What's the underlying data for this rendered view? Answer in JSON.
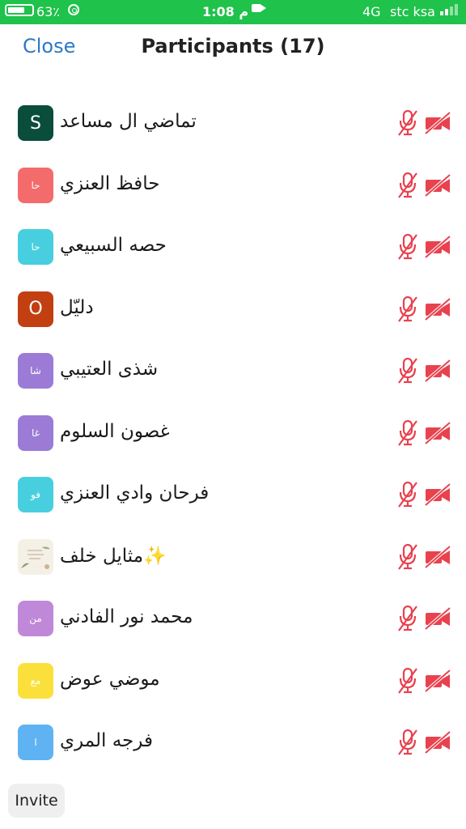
{
  "status_bar": {
    "battery": "63٪",
    "time": "1:08 م",
    "network": "4G",
    "carrier": "stc ksa"
  },
  "header": {
    "close_label": "Close",
    "title": "Participants (17)"
  },
  "participants": [
    {
      "name": "تماضي ال مساعد",
      "avatar_text": "S",
      "avatar_color": "#0b4d3b",
      "avatar_type": "letter"
    },
    {
      "name": "حافظ العنزي",
      "avatar_text": "حا",
      "avatar_color": "#f36b6b",
      "avatar_type": "initials"
    },
    {
      "name": "حصه السبيعي",
      "avatar_text": "حا",
      "avatar_color": "#47cfe0",
      "avatar_type": "initials"
    },
    {
      "name": "دليّل",
      "avatar_text": "O",
      "avatar_color": "#c23f12",
      "avatar_type": "letter"
    },
    {
      "name": "شذى العتيبي",
      "avatar_text": "شا",
      "avatar_color": "#9b7bd6",
      "avatar_type": "initials"
    },
    {
      "name": "غصون السلوم",
      "avatar_text": "غا",
      "avatar_color": "#9b7bd6",
      "avatar_type": "initials"
    },
    {
      "name": "فرحان وادي العنزي",
      "avatar_text": "فو",
      "avatar_color": "#47cfe0",
      "avatar_type": "initials"
    },
    {
      "name": "مثايل خلف✨",
      "avatar_text": "",
      "avatar_color": "#f3efe4",
      "avatar_type": "photo"
    },
    {
      "name": "محمد نور الفادني",
      "avatar_text": "من",
      "avatar_color": "#c088d8",
      "avatar_type": "initials"
    },
    {
      "name": "موضي عوض",
      "avatar_text": "مع",
      "avatar_color": "#fbe03b",
      "avatar_type": "initials"
    },
    {
      "name": "فرجه المري",
      "avatar_text": "ا",
      "avatar_color": "#5fb3f3",
      "avatar_type": "initials"
    }
  ],
  "row_icons": {
    "mic": "microphone-muted-icon",
    "video": "video-off-icon",
    "color": "#e8424f"
  },
  "footer": {
    "invite_label": "Invite"
  }
}
